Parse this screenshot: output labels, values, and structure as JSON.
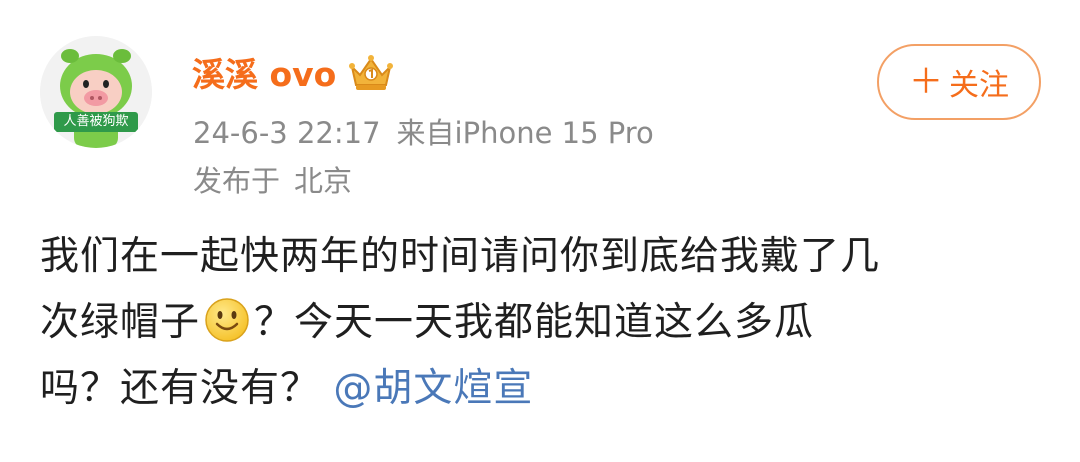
{
  "avatar": {
    "caption": "人善被狗欺",
    "icon": "pig-avatar-icon"
  },
  "user": {
    "name": "溪溪 ovo",
    "badge_icon": "crown-icon"
  },
  "meta": {
    "date": "24-6-3 22:17",
    "source": "来自iPhone 15 Pro",
    "location_label": "发布于",
    "location": "北京"
  },
  "follow_button": {
    "plus": "＋",
    "label": "关注"
  },
  "post": {
    "line1": "我们在一起快两年的时间请问你到底给我戴了几",
    "line2_before_emoji": "次绿帽子",
    "emoji_icon": "smile-emoji-icon",
    "line2_after_emoji": "？今天一天我都能知道这么多瓜",
    "line3_text": "吗？还有没有？",
    "mention": "@胡文煊宣"
  },
  "colors": {
    "username": "#f56d1b",
    "follow_border": "#f3a065",
    "meta": "#8a8a8a",
    "mention": "#4a78b8",
    "avatar_caption_bg": "#2f9a4a"
  }
}
